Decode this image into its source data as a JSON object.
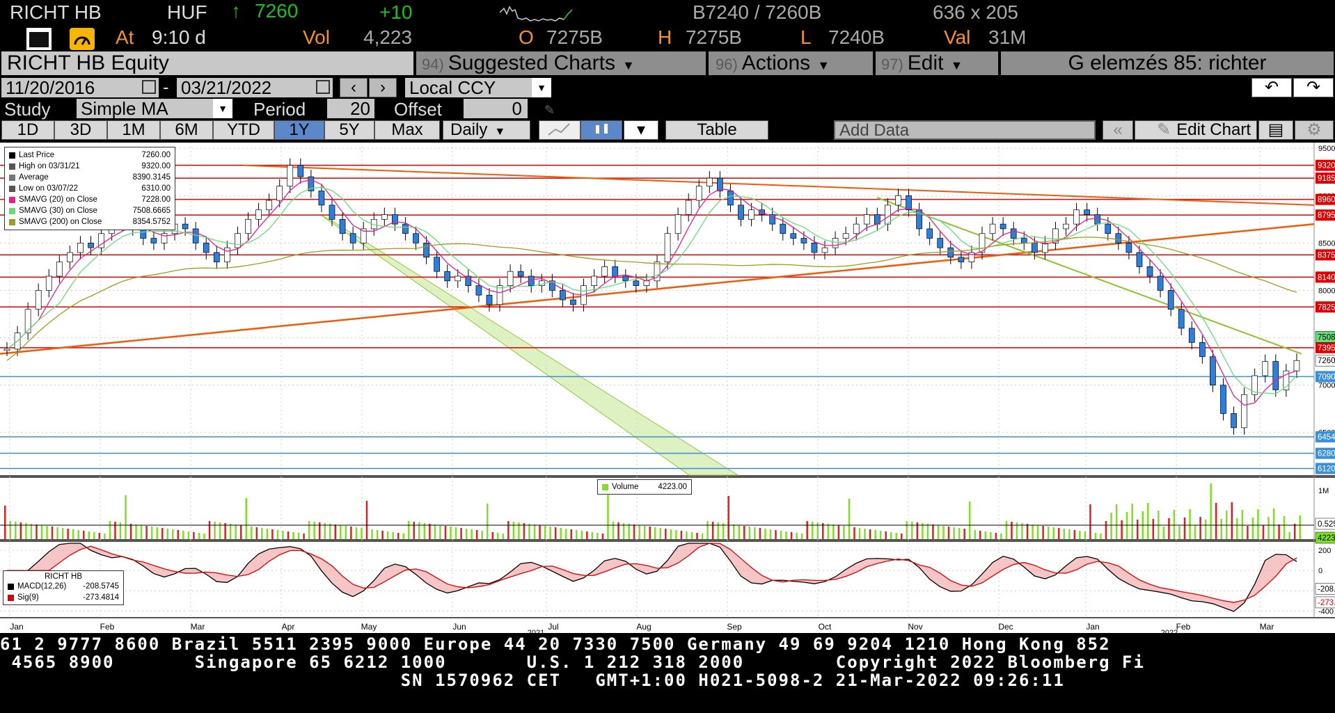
{
  "header": {
    "ticker": "RICHT HB",
    "currency": "HUF",
    "arrow": "↑",
    "last": "7260",
    "change": "+10",
    "bid_ask": "B7240 / 7260B",
    "size": "636 x 205",
    "at_label": "At",
    "time": "9:10 d",
    "vol_label": "Vol",
    "vol": "4,223",
    "o_label": "O",
    "open": "7275B",
    "h_label": "H",
    "high": "7275B",
    "l_label": "L",
    "low": "7240B",
    "val_label": "Val",
    "val": "31M"
  },
  "menubar": {
    "security": "RICHT HB Equity",
    "suggested_num": "94)",
    "suggested": "Suggested Charts",
    "actions_num": "96)",
    "actions": "Actions",
    "edit_num": "97)",
    "edit": "Edit",
    "title": "G elemzés 85: richter"
  },
  "controls": {
    "start_date": "11/20/2016",
    "dash": "-",
    "end_date": "03/21/2022",
    "currency_mode": "Local CCY",
    "study_label": "Study",
    "study": "Simple MA",
    "period_label": "Period",
    "period": "20",
    "offset_label": "Offset",
    "offset": "0"
  },
  "toolbar": {
    "ranges": [
      "1D",
      "3D",
      "1M",
      "6M",
      "YTD",
      "1Y",
      "5Y",
      "Max"
    ],
    "selected_range": "1Y",
    "frequency": "Daily",
    "table": "Table",
    "add_data": "Add Data",
    "edit_chart": "Edit Chart"
  },
  "legend_price": [
    {
      "label": "Last Price",
      "value": "7260.00",
      "color": "#000000"
    },
    {
      "label": "High on 03/31/21",
      "value": "9320.00",
      "color": "#555555"
    },
    {
      "label": "Average",
      "value": "8390.3145",
      "color": "#777777"
    },
    {
      "label": "Low on 03/07/22",
      "value": "6310.00",
      "color": "#555555"
    },
    {
      "label": "SMAVG (20)  on Close",
      "value": "7228.00",
      "color": "#e8208c"
    },
    {
      "label": "SMAVG (30)  on Close",
      "value": "7508.6665",
      "color": "#66dd77"
    },
    {
      "label": "SMAVG (200)  on Close",
      "value": "8354.5752",
      "color": "#a09a20"
    }
  ],
  "legend_volume": {
    "label": "Volume",
    "value": "4223.00"
  },
  "legend_macd": {
    "title": "RICHT HB",
    "rows": [
      {
        "label": "MACD(12,26)",
        "value": "-208.5745",
        "color": "#000000"
      },
      {
        "label": "Sig(9)",
        "value": "-273.4814",
        "color": "#e00000"
      }
    ]
  },
  "chart_data": {
    "type": "candlestick",
    "price_ticks": [
      9500,
      9000,
      8500,
      8000,
      7500,
      7000,
      6500
    ],
    "price_ylim": [
      6050,
      9560
    ],
    "hlines": [
      {
        "label": "9320.00",
        "value": 9320,
        "color": "#e00000"
      },
      {
        "label": "9185.00",
        "value": 9185,
        "color": "#e00000"
      },
      {
        "label": "8960.4717",
        "value": 8960.4717,
        "color": "#e00000"
      },
      {
        "label": "8795.00",
        "value": 8795,
        "color": "#e00000"
      },
      {
        "label": "8375.00",
        "value": 8375,
        "color": "#e00000"
      },
      {
        "label": "8140.00",
        "value": 8140,
        "color": "#e00000"
      },
      {
        "label": "7825.00",
        "value": 7825,
        "color": "#e00000"
      },
      {
        "label": "7395.00",
        "value": 7395,
        "color": "#e00000"
      },
      {
        "label": "7090.00",
        "value": 7090,
        "color": "#3a8fd8"
      },
      {
        "label": "6454.228",
        "value": 6454.228,
        "color": "#3a8fd8"
      },
      {
        "label": "6280.00",
        "value": 6280,
        "color": "#3a8fd8"
      },
      {
        "label": "6120.00",
        "value": 6120,
        "color": "#3a8fd8"
      }
    ],
    "right_labels": [
      {
        "label": "7508.6665",
        "value": 7508.6665,
        "color": "#66dd77"
      },
      {
        "label": "7260.00",
        "value": 7260,
        "color": "#000000"
      }
    ],
    "closes": [
      7380,
      7550,
      7800,
      8000,
      8150,
      8300,
      8400,
      8500,
      8450,
      8600,
      8700,
      8750,
      8650,
      8550,
      8500,
      8600,
      8700,
      8650,
      8500,
      8400,
      8300,
      8450,
      8600,
      8750,
      8850,
      8950,
      9100,
      9320,
      9200,
      9050,
      8900,
      8750,
      8600,
      8500,
      8650,
      8750,
      8800,
      8700,
      8600,
      8500,
      8350,
      8200,
      8100,
      8150,
      8050,
      7950,
      7850,
      8050,
      8200,
      8150,
      8050,
      8100,
      8000,
      7900,
      7850,
      8050,
      8150,
      8250,
      8150,
      8100,
      8050,
      8100,
      8300,
      8600,
      8800,
      8950,
      9100,
      9185,
      9050,
      8900,
      8750,
      8850,
      8800,
      8700,
      8600,
      8550,
      8500,
      8400,
      8450,
      8550,
      8600,
      8700,
      8800,
      8700,
      8900,
      9000,
      8850,
      8650,
      8550,
      8450,
      8350,
      8300,
      8400,
      8600,
      8700,
      8650,
      8550,
      8500,
      8400,
      8500,
      8650,
      8700,
      8850,
      8800,
      8700,
      8600,
      8500,
      8400,
      8250,
      8150,
      8000,
      7800,
      7600,
      7450,
      7300,
      7000,
      6700,
      6550,
      6900,
      7100,
      7250,
      6950,
      7150,
      7260
    ],
    "volume_ticks": [
      {
        "label": "1M",
        "value": 1000000
      }
    ],
    "volume_right_labels": [
      {
        "label": "0.525M",
        "value": 525000
      },
      {
        "label": "4223.00",
        "value": 4223
      }
    ],
    "macd_ticks": [
      200,
      0,
      -200,
      -400
    ],
    "macd_ylim": [
      -460,
      270
    ],
    "macd_right_labels": [
      {
        "label": "-208.5745",
        "value": -208.5745
      },
      {
        "label": "-273.4814",
        "value": -273.4814
      }
    ],
    "months": [
      "Jan",
      "Feb",
      "Mar",
      "Apr",
      "May",
      "Jun",
      "Jul",
      "Aug",
      "Sep",
      "Oct",
      "Nov",
      "Dec",
      "Jan",
      "Feb",
      "Mar"
    ],
    "years": [
      "2021",
      "2022"
    ]
  },
  "footer": {
    "line1": "61 2 9777 8600 Brazil 5511 2395 9000 Europe 44 20 7330 7500 Germany 49 69 9204 1210 Hong Kong 852",
    "line2": " 4565 8900       Singapore 65 6212 1000       U.S. 1 212 318 2000        Copyright 2022 Bloomberg Fi",
    "line3": "                                   SN 1570962 CET   GMT+1:00 H021-5098-2 21-Mar-2022 09:26:11"
  }
}
